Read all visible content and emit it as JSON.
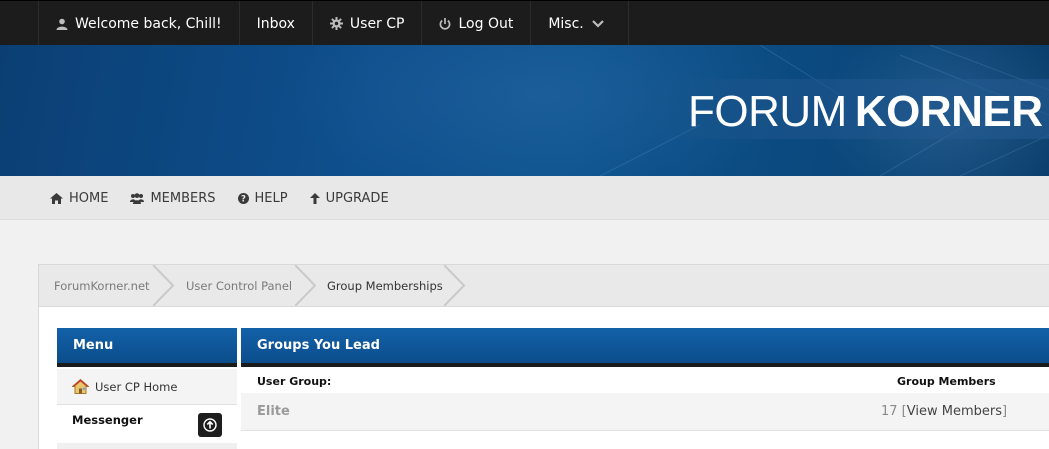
{
  "topnav": {
    "welcome": "Welcome back, Chill!",
    "inbox": "Inbox",
    "user_cp": "User CP",
    "logout": "Log Out",
    "misc": "Misc."
  },
  "logo": {
    "light": "FORUM",
    "bold": "KORNER"
  },
  "mainnav": {
    "home": "HOME",
    "members": "MEMBERS",
    "help": "HELP",
    "upgrade": "UPGRADE"
  },
  "breadcrumb": [
    "ForumKorner.net",
    "User Control Panel",
    "Group Memberships"
  ],
  "menu": {
    "title": "Menu",
    "items": [
      {
        "label": "User CP Home"
      }
    ],
    "section": "Messenger"
  },
  "groups_panel": {
    "title": "Groups You Lead",
    "columns": [
      "User Group:",
      "Group Members"
    ],
    "rows": [
      {
        "group": "Elite",
        "count": "17",
        "view_label": "View Members"
      }
    ]
  },
  "colors": {
    "topbar": "#1c1c1c",
    "header_blue": "#0b4d8c",
    "nav_bg": "#e8e8e8"
  },
  "icons": [
    "user-icon",
    "gear-icon",
    "power-icon",
    "chevron-down-icon",
    "home-icon",
    "members-icon",
    "help-icon",
    "arrow-up-icon",
    "house-icon",
    "scroll-top-icon"
  ]
}
